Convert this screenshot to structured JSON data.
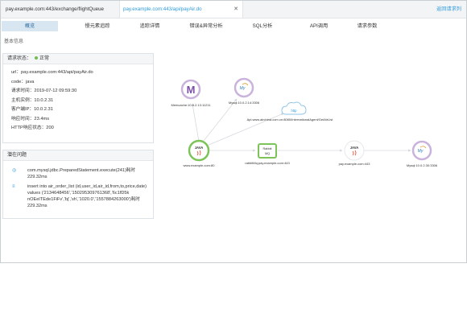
{
  "tabs": [
    {
      "label": "pay.example.com:443/exchange/flightQueue",
      "active": false
    },
    {
      "label": "pay.example.com:443/api/payAir.do",
      "active": true
    }
  ],
  "return_link": "返回请求列",
  "subtabs": [
    "概览",
    "慢元素追踪",
    "追踪详情",
    "错误&异常分析",
    "SQL分析",
    "API调用",
    "请求参数"
  ],
  "basic_info": {
    "section_title": "基本信息",
    "status_label": "请求状态：",
    "status_value": "正常",
    "fields": [
      "url：pay.example.com:443/api/payAir.do",
      "code：java",
      "请求时间：2019-07-12 09:59:30",
      "主机实例：10.0.2.31",
      "客户端IP：10.0.2.31",
      "响应时间：23.4ms",
      "HTTP响应状态：200"
    ]
  },
  "problems": {
    "title": "潜在问题",
    "items": [
      "com.mysql.jdbc.PreparedStatement.execute(241)耗时229.32ms",
      "insert into air_order_list (id,user_id,air_id,from,to,price,date) values ('2134648456','1502953097613​68','6c1fD5​k​nOEeITEde1FiFv','bj','sh','1020.0','1557884263000')耗时229.32ms"
    ]
  },
  "graph": {
    "nodes": [
      {
        "id": "memcache",
        "label": "Memcache:10.0.2.13:11211",
        "icon": "memcache-icon"
      },
      {
        "id": "mysql-top",
        "label": "Mysql:10.0.2.14:3306",
        "icon": "mysql-icon"
      },
      {
        "id": "http",
        "label": "Api.www.airchina.com.cn:8080/InternationalAgent/GetAirList",
        "icon": "http-cloud-icon",
        "icon_text": "http"
      },
      {
        "id": "java-www",
        "label": "www.example.com:80",
        "icon": "java-icon",
        "icon_text": "JAVA"
      },
      {
        "id": "rabbit",
        "label": "rabbitMq:pay.example.com:443",
        "icon": "rabbitmq-icon",
        "icon_text": "Rabbit MQ"
      },
      {
        "id": "java-pay",
        "label": "pay.example.com:443",
        "icon": "java-icon",
        "icon_text": "JAVA"
      },
      {
        "id": "mysql-right",
        "label": "Mysql:10.0.2.30:3306",
        "icon": "mysql-icon"
      }
    ]
  },
  "colors": {
    "accent": "#2e9bdc",
    "active_tab_bg": "#d8e6f1",
    "healthy": "#6cc04a",
    "node_ring": "#c9b3dc",
    "memcache": "#7b4fa8"
  }
}
